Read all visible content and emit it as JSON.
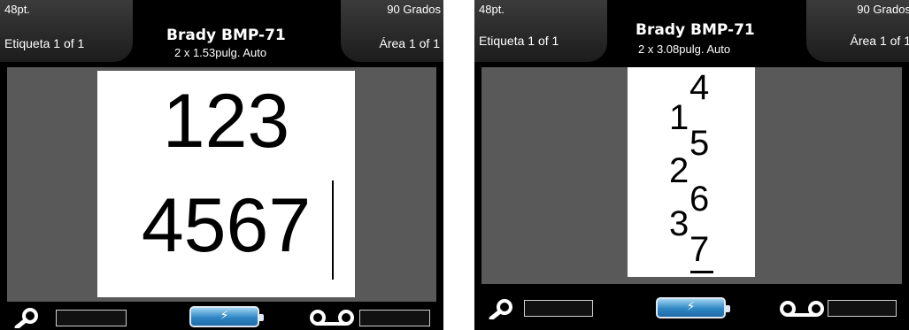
{
  "screens": [
    {
      "font_size": "48pt.",
      "rotation": "90 Grados",
      "label_counter": "Etiqueta  1 of 1",
      "printer_model": "Brady BMP-71",
      "label_dims": "2 x 1.53pulg.  Auto",
      "area_counter": "Área  1 of 1",
      "label_lines": [
        "123",
        "4567"
      ]
    },
    {
      "font_size": "48pt.",
      "rotation": "90 Grados",
      "label_counter": "Etiqueta  1 of 1",
      "printer_model": "Brady BMP-71",
      "label_dims": "2 x 3.08pulg.  Auto",
      "area_counter": "Área  1 of 1",
      "label_chars": [
        "1",
        "2",
        "3",
        "4",
        "5",
        "6",
        "7"
      ]
    }
  ],
  "footer": {
    "icons": [
      "search-icon",
      "battery-charging-icon",
      "tape-cassette-icon"
    ],
    "battery_charging": true
  },
  "colors": {
    "canvas": "#595959",
    "battery": "#2f86c4",
    "label": "#ffffff"
  }
}
